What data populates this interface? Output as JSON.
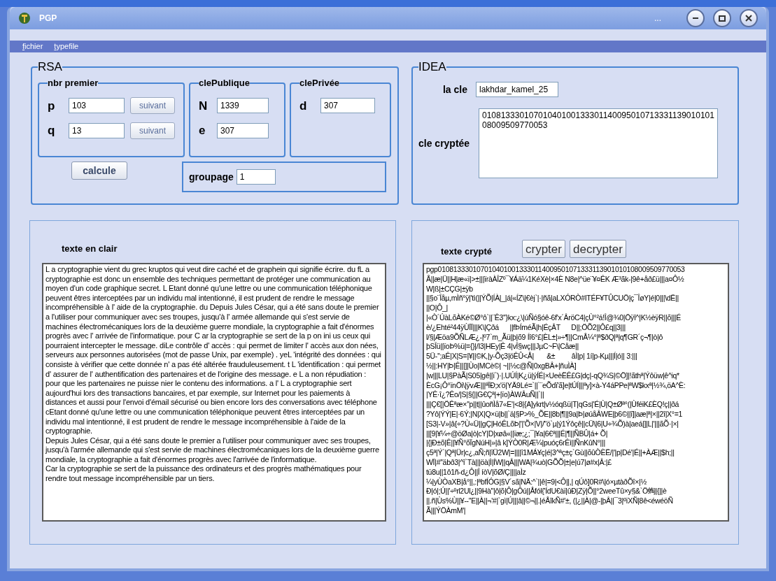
{
  "window": {
    "title": "PGP",
    "title_extra": "..."
  },
  "menu": [
    "fichier",
    "typefile"
  ],
  "rsa": {
    "title": "RSA",
    "nbr_premier": {
      "title": "nbr premier",
      "fields": [
        {
          "label": "p",
          "value": "103",
          "button": "suivant"
        },
        {
          "label": "q",
          "value": "13",
          "button": "suivant"
        }
      ]
    },
    "cle_publique": {
      "title": "clePublique",
      "fields": [
        {
          "label": "N",
          "value": "1339"
        },
        {
          "label": "e",
          "value": "307"
        }
      ]
    },
    "cle_privee": {
      "title": "clePrivée",
      "fields": [
        {
          "label": "d",
          "value": "307"
        }
      ]
    },
    "calcule_button": "calcule",
    "groupage": {
      "label": "groupage",
      "value": "1"
    }
  },
  "idea": {
    "title": "IDEA",
    "cle": {
      "label": "la cle",
      "value": "lakhdar_kamel_25"
    },
    "cle_cryptee": {
      "label": "cle cryptée",
      "value": "0108133301070104010013330114009501071333113901010108009509770053"
    }
  },
  "plain": {
    "label": "texte en clair",
    "paragraphs": [
      " L a cryptographie vient du grec kruptos qui veut dire caché et  de graphein qui signifie écrire. du fL a cryptographie est donc un ensemble des techniques permettant de protéger une communication au moyen d'un code graphique secret.  L  Etant donné qu'une lettre ou  une communication téléphonique peuvent êtres interceptées par  un individu mal intentionné, il est prudent de rendre le message incompréhensible à l' aide de  la cryptographie. du Depuis Jules César, qui a été sans doute le premier a l'utiliser pour communiquer avec ses troupes, jusqu'à l' armée allemande qui s'est servie de machines électromécaniques lors de  la deuxième guerre mondiale, la cryptographie a fait d'énormes progrès avec l' arrivée de l'informatique. pour C ar la cryptographie se sert de  la p on ini us ceux qui pourraient intercepter le message. diLe contrôle d' accès : qui permet de limiter l' accès aux don nées, serveurs aux personnes autorisées (mot de passe Unix, par exemple)  . yeL 'intégrité des données : qui consiste à vérifier que cette donnée n' a pas été altérée frauduleusement. t L 'identification : qui permet d' assurer de l' authentification des partenaires et  de l'origine des message. e L a non répudiation : pour  que les partenaires ne puisse nier le contenu des informations.  a l' L a cryptographie sert aujourd'hui lors des transactions bancaires, et  par exemple, sur Internet pour  les paiements à distances et aussi pour l'envoi d'émail sécurisé ou bien encore lors des conversations avec téléphone cEtant donné qu'une lettre ou une communication téléphonique peuvent êtres interceptées par un individu mal intentionné, il est prudent de rendre le message incompréhensible à l'aide de la cryptographie.",
      "Depuis Jules César, qui a été sans doute le premier a l'utiliser pour communiquer avec ses troupes, jusqu'à l'armée allemande qui s'est servie de machines électromécaniques lors de la deuxième guerre mondiale, la cryptographie a fait d'énormes progrès avec l'arrivée de l'informatique.",
      "Car la cryptographie se sert de la puissance des ordinateurs et des progrès mathématiques pour rendre tout message incompréhensible par un tiers."
    ]
  },
  "cipher": {
    "label": "texte crypté",
    "buttons": [
      "crypter",
      "decrypter"
    ],
    "lines": [
      "pgp0108133301070104010013330114009501071333113901010108009509770053",
      "Å||æ|Ü||H|æ«ï|>±|||ïràÀÎZº¯¥Áä¼1KéXè|×4È N8e|^üe¨¥¤ÊK Æ³ãk-|9ê+åð£ü|||a¤Ô½",
      "W|ß|±CÇG|±ÿb",
      "||§o¨Îåµ,mÌñ°ÿ|'tì(||ÝÕ|ÍÀ|_|á|«ÍZ\\|€èj`|·|ñã|aLXÓRÒ#ITÉF¥TÛCUÖ|ç¯ÎøY|é|0|||\\dË||",
      "||O|Ô_|",
      "|«Ò´ÚàLõÀKé©Ø°ô`||¨Ê3''}kx:¿\\|úÑó§óê-6f'x´ÂröC4|çÙ°²á!Î@¾0|Öÿî^|K½èÿR||õ|||É",
      "è/¿Ehté²44ÿÙÏÏ|||K\\|Çðá      ||fÞÍméÃ|h|ÉçÂT      D||;ÖÕ2||Ô£q||3|||",
      "l/§|Æöa9ÕÑLÆ¿-|º7`m_Ãü|þ|õ9 Íî6°£|ÈL±|»÷¶||CmÅ¼°|ª$ðQ|ª|q¶GR´ç¬¶|ò|ô",
      "þSÎü||ïoÞ%ü|={}|/I3|HEy|Ê 4|vÎ§wç|||JµC~F\\|Cåæ||",
      "5Ü-'';aÊ|X|S=|¥||©K,|y-Õç3|öÊÛ<Å|       &±         âÌ|p| 1í|p-Kµ|||Í|ó|| 3:|||",
      "½||:HY|Þ|Ê|||]|Ùo|MCè©| ~||½c@Ñ|0xgBÂ+|ñuÌÀ]",
      "|w|||LU|§PàÃ|S05|gê||ï`)·|.UÚÍ|K¿ü|ýÍÉ|×UeèËÊ£G|dç|-qQ¾S|©Ö]|!ãthª|Ýôüw|ê^iq*",
      "ÈcG¡Ô°ïnÖi\\|ÿvÆ|||ªÏÐ;x'ö|YÄ9Lé=`||`¨eÕdï'ã]e|tÚÍ|||ªy]×à-Y4áPPe|ªW$kxª|½¾,öA^È:",
      "|YÊ·î¿?Êo/|S|§{||G€Çª|+|ïo}ÀWÂuÑ||`||",
      "|||Ç€[|ÖÊªæ×''p||t||ûoñÌå7«E'|<8|{A]ykrt|v½óqßü|T|qGs|'É|Ù|Q±Øª°(|ÙféiK£ÈQ!ç||ðá",
      "?Yô|ÝÝ|E|·6Ý;|N|X|Q×ü|b||`ä|§P>%_ÕE||8b|¶||9a|Þ|øúåÂWE|þ6©||î]|aæ|ª|×||2î|X°=1",
      "[S3|-V»|â{÷?Ù«Ü||gÇ|HóÊLõÞ|'|'Õ×|V|/''ö`µ|ý1Ýôçê||cÜ\\|6|U÷¾Õ)à|aeá|]|L|'|||ãÕ·|×|",
      "||[9|¥¼÷@öØa|ò|cY|D|xøâ«||ïæ;¿;¯|¥a|6€ª|||É|¶||ÑBÛ|á+ Õ|",
      "|{|Ð±õ|Ê||¥Ñ°õÏgNúH|»|â k]ÝÒ0R|Æ¼|puóç6rÊì||ÑnKûN°|||",
      "ç5ª|Ý`|Qª|Ür|c¿,aÑ;ñ|îÜ2W|=||||î1MÁ¥ç|é|3^ªç±ç`Gù||õûÒÈË/|'|p|Dé'|É||+ÀÆ||$h;||",
      "WÏ|#''äbð3|^î`Tà|||öà|Ì|ÍW||qÂ|||WA|¾uò|GÕÕ|±|e|ú7|ø#x|Â:|£",
      "tü8u||1ô1ñ-d¿Ô||Î íòV|õØ/Ç||||aÌz",
      "¼|yÙÒaXB|å°||,:|ªbfÍÓG|§V´sã|NÄ:^`||ê|=9|<Ô||,| qÚô]0R#\\|ó×µtàðÕî×|½",
      "Ð|ó|;Ú||'÷ºrl2Ul¿||9Hà''|ô|õ|Ô|gÔú||Åfól{'ÍdU€àï|ûÐ|Zÿ|Õ||°2weeTû×y§&`Ö蜪|{||è",
      "||.ñ|Ùs%Ù||¥--''E||À||¬'#|`gì|Ú|||â||©¬||.|éÅîkÑ#'±, (|¿||À|@-|þÂ||¯3|ºïXÑ|8ê<éwéöÑ",
      "Ã|||ÝÖÀmM'|"
    ]
  }
}
